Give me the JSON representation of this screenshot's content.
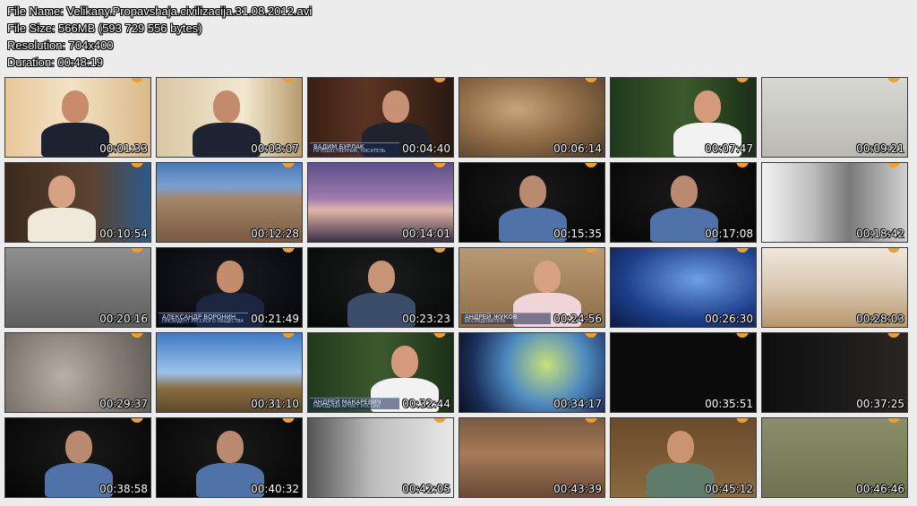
{
  "info": {
    "file_name": "File Name: Velikany.Propavshaja.civilizacija.31.08.2012.avi",
    "file_size": "File Size: 566MB (593 729 556 bytes)",
    "resolution": "Resolution: 704x400",
    "duration": "Duration: 00:48:19"
  },
  "colors": {
    "background": "#ececec",
    "channel_logo": "#f0a02a",
    "timestamp_text": "#ffffff"
  },
  "thumbnails": [
    {
      "time": "00:01:33",
      "scene": "man-interior-bright",
      "caption": null
    },
    {
      "time": "00:03:07",
      "scene": "man-skeleton",
      "caption": null
    },
    {
      "time": "00:04:40",
      "scene": "man-office",
      "caption": {
        "name": "ВАДИМ БУРЛАК",
        "role": "ПУТЕШЕСТВЕННИК, ПИСАТЕЛЬ"
      }
    },
    {
      "time": "00:06:14",
      "scene": "rock-cave",
      "caption": null
    },
    {
      "time": "00:07:47",
      "scene": "man-sunglasses-forest",
      "caption": null
    },
    {
      "time": "00:09:21",
      "scene": "newspaper-skeleton",
      "caption": null
    },
    {
      "time": "00:10:54",
      "scene": "man-globe",
      "caption": null
    },
    {
      "time": "00:12:28",
      "scene": "ruins",
      "caption": null
    },
    {
      "time": "00:14:01",
      "scene": "stonehenge-sunset",
      "caption": null
    },
    {
      "time": "00:15:35",
      "scene": "man-dark",
      "caption": null
    },
    {
      "time": "00:17:08",
      "scene": "man-dark",
      "caption": null
    },
    {
      "time": "00:18:42",
      "scene": "glass-globe",
      "caption": null
    },
    {
      "time": "00:20:16",
      "scene": "stone-relief",
      "caption": null
    },
    {
      "time": "00:21:49",
      "scene": "man-blue-dark",
      "caption": {
        "name": "АЛЕКСАНДР ВОРОНИН",
        "role": "ПРЕЗИДЕНТ РУССКОГО ОБЩЕСТВА"
      }
    },
    {
      "time": "00:23:23",
      "scene": "man-glasses-dark",
      "caption": null
    },
    {
      "time": "00:24:56",
      "scene": "man-excavation",
      "caption": {
        "name": "АНДРЕЙ ЖУКОВ",
        "role": "ИССЛЕДОВАТЕЛЬ"
      }
    },
    {
      "time": "00:26:30",
      "scene": "stone-stack-sky",
      "caption": null
    },
    {
      "time": "00:28:03",
      "scene": "golden-buddha",
      "caption": null
    },
    {
      "time": "00:29:37",
      "scene": "aztec-calendar",
      "caption": null
    },
    {
      "time": "00:31:10",
      "scene": "stonehenge-day",
      "caption": null
    },
    {
      "time": "00:32:44",
      "scene": "man-sunglasses-forest",
      "caption": {
        "name": "АНДРЕЙ МАКАРЕВИЧ",
        "role": "НАРОДНЫЙ АРТИСТ РОССИИ"
      }
    },
    {
      "time": "00:34:17",
      "scene": "earth-globe",
      "caption": null
    },
    {
      "time": "00:35:51",
      "scene": "black-frame",
      "caption": null
    },
    {
      "time": "00:37:25",
      "scene": "nefertiti",
      "caption": null
    },
    {
      "time": "00:38:58",
      "scene": "man-dark",
      "caption": null
    },
    {
      "time": "00:40:32",
      "scene": "man-dark",
      "caption": null
    },
    {
      "time": "00:42:05",
      "scene": "old-man-beard",
      "caption": null
    },
    {
      "time": "00:43:39",
      "scene": "rock-wall",
      "caption": null
    },
    {
      "time": "00:45:12",
      "scene": "man-tablet-wood",
      "caption": null
    },
    {
      "time": "00:46:46",
      "scene": "hands-statue",
      "caption": null
    }
  ]
}
